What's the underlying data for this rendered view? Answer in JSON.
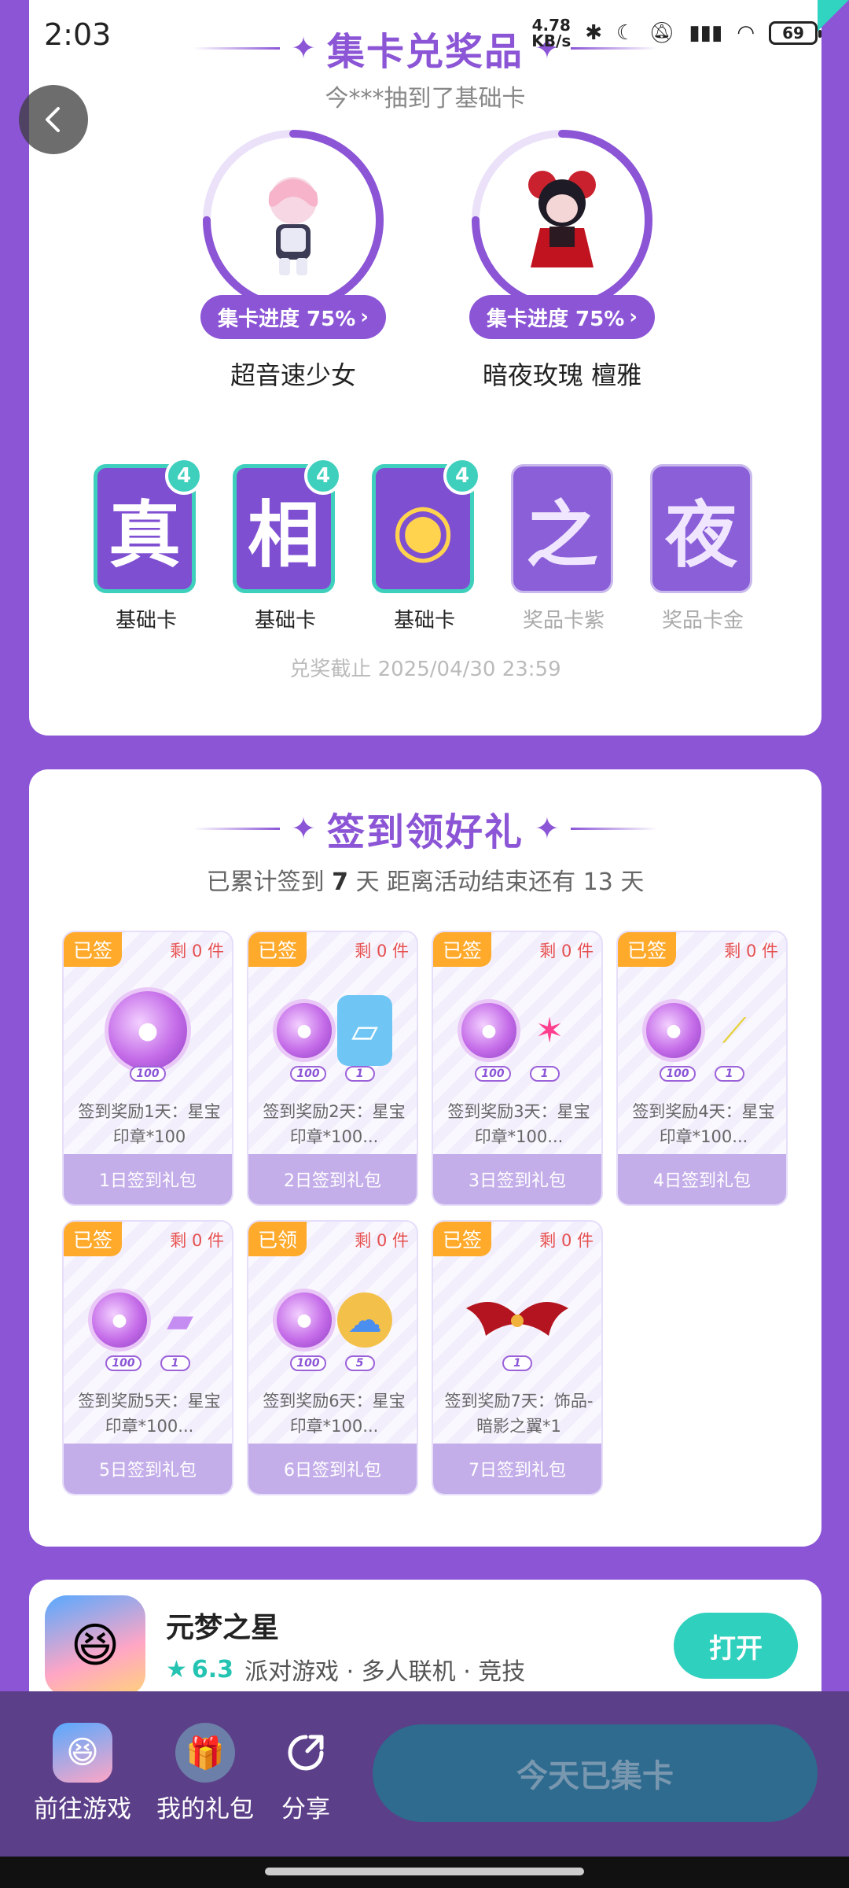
{
  "status": {
    "time": "2:03",
    "net_speed": "4.78",
    "net_unit": "KB/s",
    "battery": "69"
  },
  "collect": {
    "title": "集卡兑奖品",
    "subtitle": "今***抽到了基础卡",
    "characters": [
      {
        "name": "超音速少女",
        "progress_label": "集卡进度 75%",
        "progress": 0.75
      },
      {
        "name": "暗夜玫瑰 檀雅",
        "progress_label": "集卡进度 75%",
        "progress": 0.75
      }
    ],
    "cards": [
      {
        "glyph": "真",
        "label": "基础卡",
        "count": "4"
      },
      {
        "glyph": "相",
        "label": "基础卡",
        "count": "4"
      },
      {
        "glyph": "◉",
        "label": "基础卡",
        "count": "4"
      },
      {
        "glyph": "之",
        "label": "奖品卡紫"
      },
      {
        "glyph": "夜",
        "label": "奖品卡金"
      }
    ],
    "deadline": "兑奖截止 2025/04/30 23:59"
  },
  "checkin": {
    "title": "签到领好礼",
    "subtitle_a": "已累计签到",
    "days_count": "7",
    "subtitle_b": "天  距离活动结束还有 13 天",
    "rewards": [
      {
        "tag": "已签",
        "remaining": "剩 0 件",
        "qtys": [
          "100"
        ],
        "desc": "签到奖励1天：星宝印章*100",
        "button": "1日签到礼包"
      },
      {
        "tag": "已签",
        "remaining": "剩 0 件",
        "qtys": [
          "100",
          "1"
        ],
        "desc": "签到奖励2天：星宝印章*100...",
        "button": "2日签到礼包"
      },
      {
        "tag": "已签",
        "remaining": "剩 0 件",
        "qtys": [
          "100",
          "1"
        ],
        "desc": "签到奖励3天：星宝印章*100...",
        "button": "3日签到礼包"
      },
      {
        "tag": "已签",
        "remaining": "剩 0 件",
        "qtys": [
          "100",
          "1"
        ],
        "desc": "签到奖励4天：星宝印章*100...",
        "button": "4日签到礼包"
      },
      {
        "tag": "已签",
        "remaining": "剩 0 件",
        "qtys": [
          "100",
          "1"
        ],
        "desc": "签到奖励5天：星宝印章*100...",
        "button": "5日签到礼包"
      },
      {
        "tag": "已领",
        "remaining": "剩 0 件",
        "qtys": [
          "100",
          "5"
        ],
        "desc": "签到奖励6天：星宝印章*100...",
        "button": "6日签到礼包"
      },
      {
        "tag": "已签",
        "remaining": "剩 0 件",
        "qtys": [
          "1"
        ],
        "desc": "签到奖励7天：饰品-暗影之翼*1",
        "button": "7日签到礼包"
      }
    ]
  },
  "app": {
    "name": "元梦之星",
    "rating": "6.3",
    "tags": "派对游戏 · 多人联机 · 竞技",
    "open": "打开"
  },
  "bottom": {
    "go_game": "前往游戏",
    "my_gifts": "我的礼包",
    "share": "分享",
    "main_button": "今天已集卡"
  },
  "colors": {
    "accent": "#8b55d6",
    "teal": "#2fd0bd",
    "tag": "#ffaa2b"
  }
}
